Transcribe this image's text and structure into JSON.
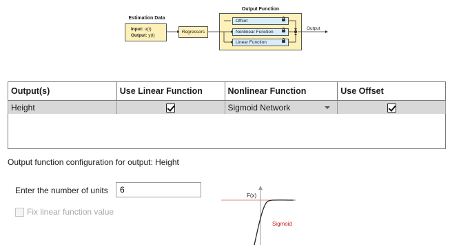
{
  "diagram": {
    "estimation_data_title": "Estimation Data",
    "input_label": "Input:",
    "input_value": "u(t)",
    "output_label": "Output:",
    "output_value": "y(t)",
    "regressors_label": "Regressors",
    "output_function_title": "Output Function",
    "offset_label": "Offset",
    "nonlinear_label": "Nonlinear Function",
    "linear_label": "Linear Function",
    "output_arrow_label": "Output"
  },
  "table": {
    "headers": [
      "Output(s)",
      "Use Linear Function",
      "Nonlinear Function",
      "Use Offset"
    ],
    "rows": [
      {
        "output": "Height",
        "use_linear": true,
        "nonlinear": "Sigmoid Network",
        "use_offset": true
      }
    ]
  },
  "config": {
    "heading": "Output function configuration for output: Height",
    "units_label": "Enter the number of units",
    "units_value": "6",
    "fix_linear_label": "Fix linear function value",
    "fix_linear_checked": false
  },
  "plot": {
    "y_label": "F(x)",
    "curve_label": "Sigmoid",
    "curve_color": "#cc2222"
  }
}
